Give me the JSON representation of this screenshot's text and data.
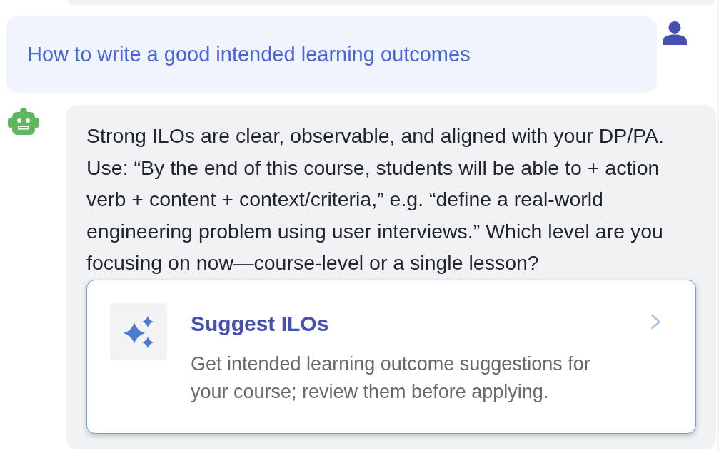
{
  "messages": [
    {
      "kind": "user",
      "text": "How to write a good intended learning outcomes"
    },
    {
      "kind": "assistant",
      "text": "Strong ILOs are clear, observable, and aligned with your DP/PA. Use: “By the end of this course, students will be able to + action verb + content + context/criteria,” e.g. “define a real-world engineering problem using user interviews.” Which level are you focusing on now—course-level or a single lesson?",
      "action_card": {
        "title": "Suggest ILOs",
        "description": "Get intended learning outcome suggestions for your course; review them before applying."
      }
    }
  ]
}
